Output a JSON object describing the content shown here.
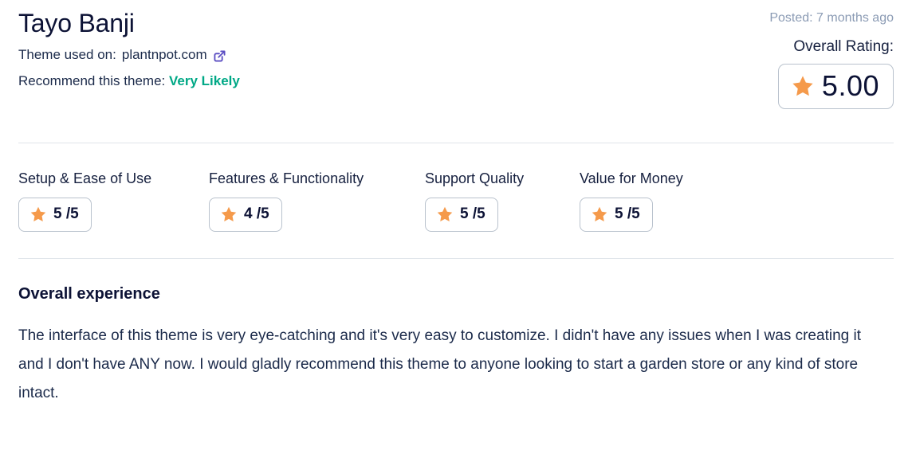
{
  "review": {
    "reviewer_name": "Tayo Banji",
    "theme_used_label": "Theme used on:",
    "theme_site": "plantnpot.com",
    "external_link_icon": "external-link-icon",
    "recommend_label": "Recommend this theme:",
    "recommend_value": "Very Likely",
    "posted": "Posted: 7 months ago",
    "overall_rating_label": "Overall Rating:",
    "overall_rating_value": "5.00",
    "overall_star_icon": "star-icon",
    "categories": [
      {
        "label": "Setup & Ease of Use",
        "score": "5 /5",
        "star_icon": "star-icon"
      },
      {
        "label": "Features & Functionality",
        "score": "4 /5",
        "star_icon": "star-icon"
      },
      {
        "label": "Support Quality",
        "score": "5 /5",
        "star_icon": "star-icon"
      },
      {
        "label": "Value for Money",
        "score": "5 /5",
        "star_icon": "star-icon"
      }
    ],
    "experience_title": "Overall experience",
    "experience_body": "The interface of this theme is very eye-catching and it's very easy to customize. I didn't have any issues when I was creating it and I don't have ANY now. I would gladly recommend this theme to anyone looking to start a garden store or any kind of store intact."
  },
  "colors": {
    "accent_star": "#f59a4b",
    "recommend_green": "#00a886",
    "link_purple": "#5b4ec2",
    "text_navy": "#0c1235",
    "muted_gray": "#8b9bb4",
    "divider": "#dfe4ea",
    "border": "#b9c2cd"
  }
}
